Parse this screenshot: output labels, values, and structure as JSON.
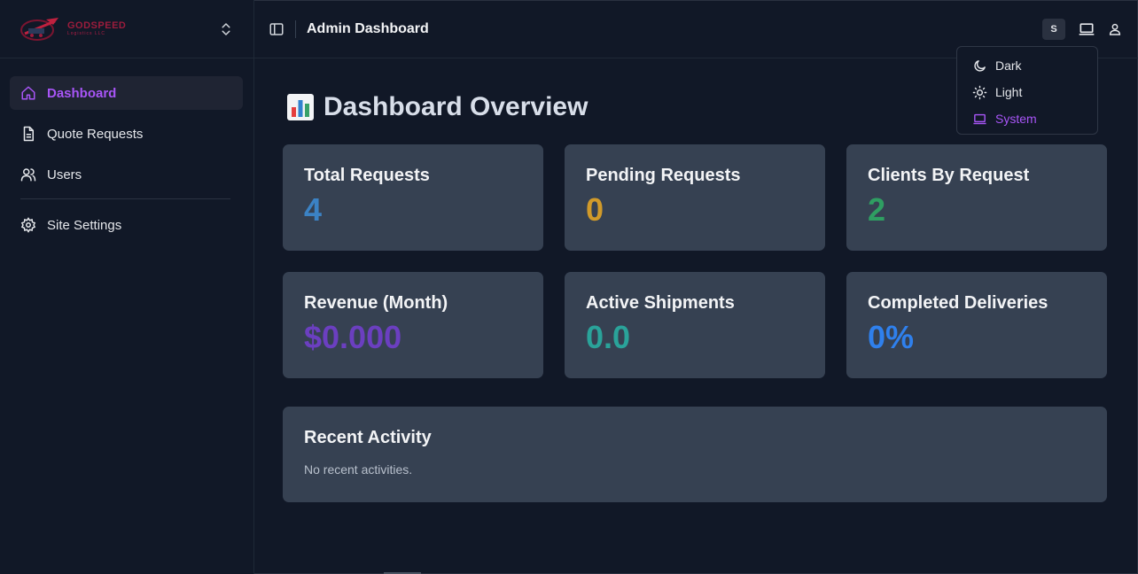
{
  "app": {
    "logo": {
      "brand_line1": "GODSPEED",
      "brand_line2": "Logistics LLC"
    }
  },
  "sidebar": {
    "items": [
      {
        "label": "Dashboard",
        "icon": "home-icon",
        "active": true
      },
      {
        "label": "Quote Requests",
        "icon": "file-text-icon",
        "active": false
      },
      {
        "label": "Users",
        "icon": "users-icon",
        "active": false
      }
    ],
    "settings": {
      "label": "Site Settings",
      "icon": "gear-icon"
    }
  },
  "topbar": {
    "title": "Admin Dashboard",
    "avatar_initial": "S"
  },
  "theme_menu": {
    "options": [
      {
        "label": "Dark",
        "icon": "moon-icon",
        "selected": false
      },
      {
        "label": "Light",
        "icon": "sun-icon",
        "selected": false
      },
      {
        "label": "System",
        "icon": "laptop-icon",
        "selected": true
      }
    ]
  },
  "main": {
    "title": "Dashboard Overview",
    "title_icon": "bar-chart-emoji",
    "stats": [
      {
        "title": "Total Requests",
        "value": "4",
        "color": "#3b82c4"
      },
      {
        "title": "Pending Requests",
        "value": "0",
        "color": "#d19a2a"
      },
      {
        "title": "Clients By Request",
        "value": "2",
        "color": "#2f9e62"
      },
      {
        "title": "Revenue (Month)",
        "value": "$0.000",
        "color": "#6b3fc0"
      },
      {
        "title": "Active Shipments",
        "value": "0.0",
        "color": "#2aa39a"
      },
      {
        "title": "Completed Deliveries",
        "value": "0%",
        "color": "#2f80ed"
      }
    ],
    "recent_activity": {
      "title": "Recent Activity",
      "empty_text": "No recent activities."
    }
  },
  "colors": {
    "background": "#111827",
    "card": "#364152",
    "accent": "#a855f7"
  }
}
